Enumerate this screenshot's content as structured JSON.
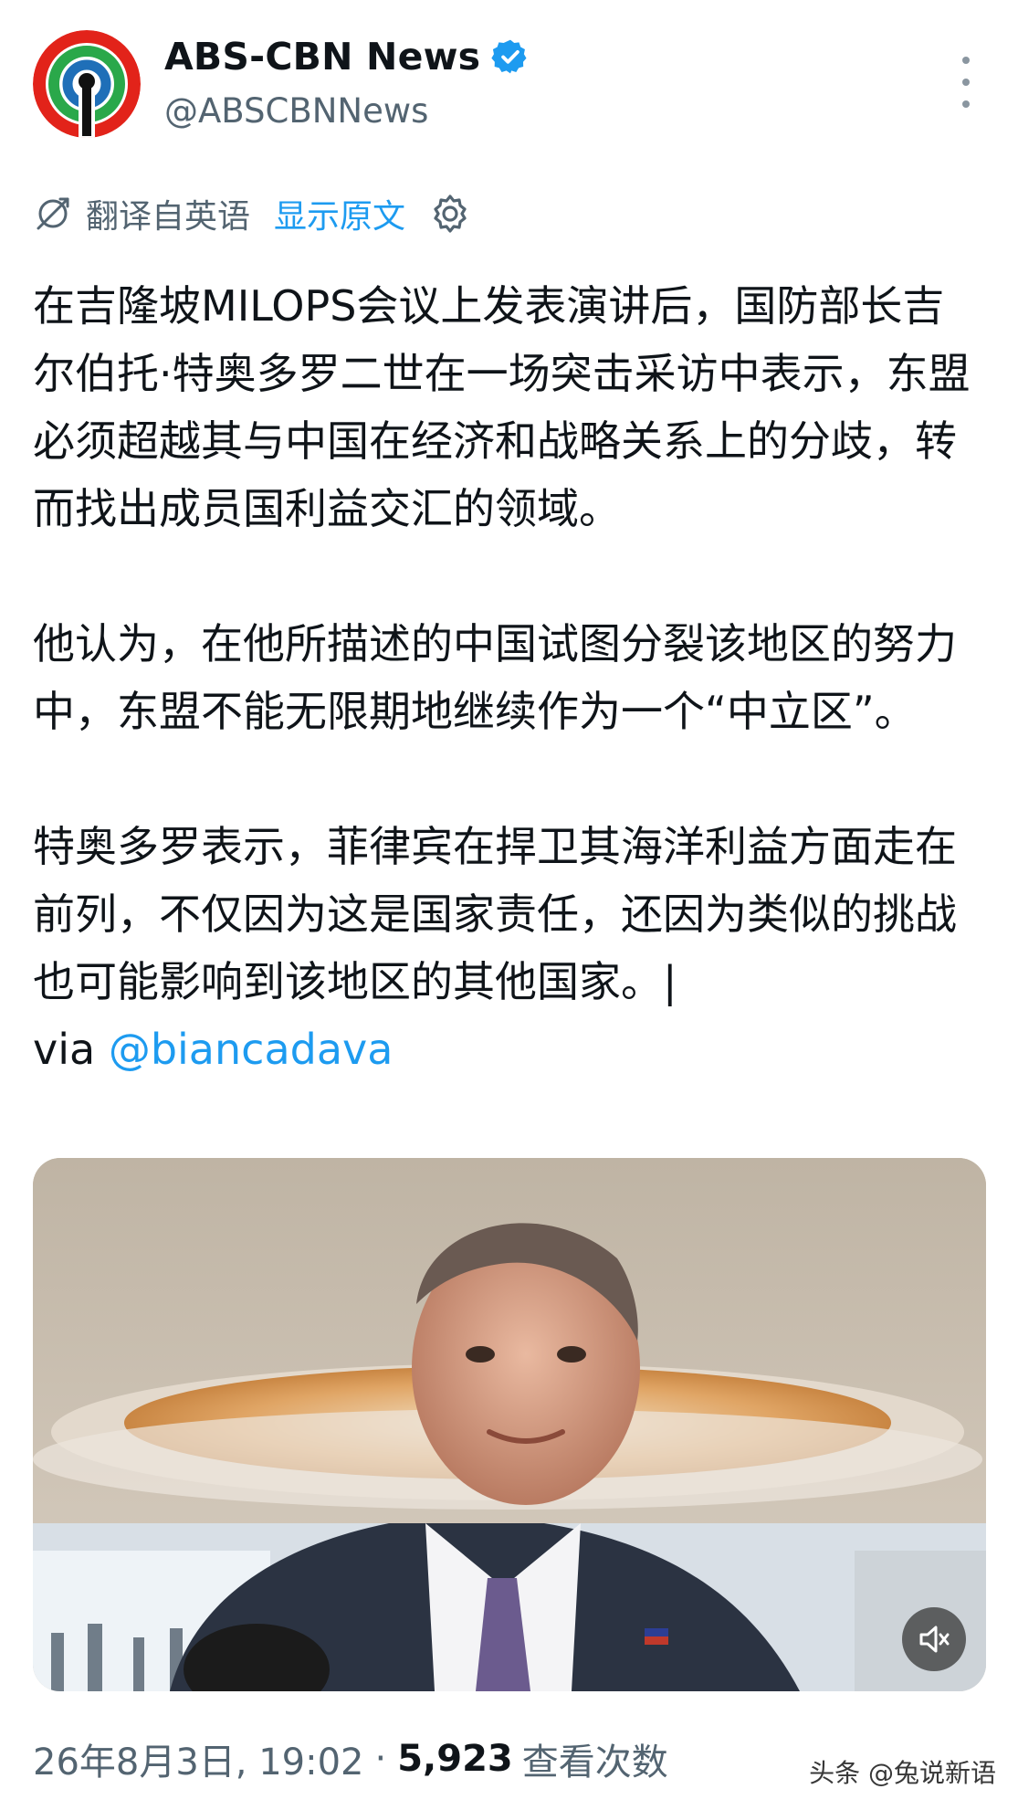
{
  "account": {
    "display_name": "ABS-CBN News",
    "handle": "@ABSCBNNews",
    "verified": true,
    "verified_color": "#1d9bf0"
  },
  "translation": {
    "label": "翻译自英语",
    "show_original_label": "显示原文"
  },
  "tweet": {
    "paragraphs": [
      "在吉隆坡MILOPS会议上发表演讲后，国防部长吉尔伯托·特奥多罗二世在一场突击采访中表示，东盟必须超越其与中国在经济和战略关系上的分歧，转而找出成员国利益交汇的领域。",
      "他认为，在他所描述的中国试图分裂该地区的努力中，东盟不能无限期地继续作为一个“中立区”。",
      "特奥多罗表示，菲律宾在捍卫其海洋利益方面走在前列，不仅因为这是国家责任，还因为类似的挑战也可能影响到该地区的其他国家。|"
    ],
    "via_prefix": "via ",
    "mention": "@biancadava"
  },
  "media": {
    "type": "video",
    "muted": true
  },
  "meta": {
    "date_time": "26年8月3日, 19:02",
    "separator": "·",
    "views_count": "5,923",
    "views_label": "查看次数"
  },
  "watermark": "头条 @兔说新语",
  "colors": {
    "link": "#1d9bf0",
    "secondary_text": "#536471",
    "primary_text": "#0f1419"
  }
}
